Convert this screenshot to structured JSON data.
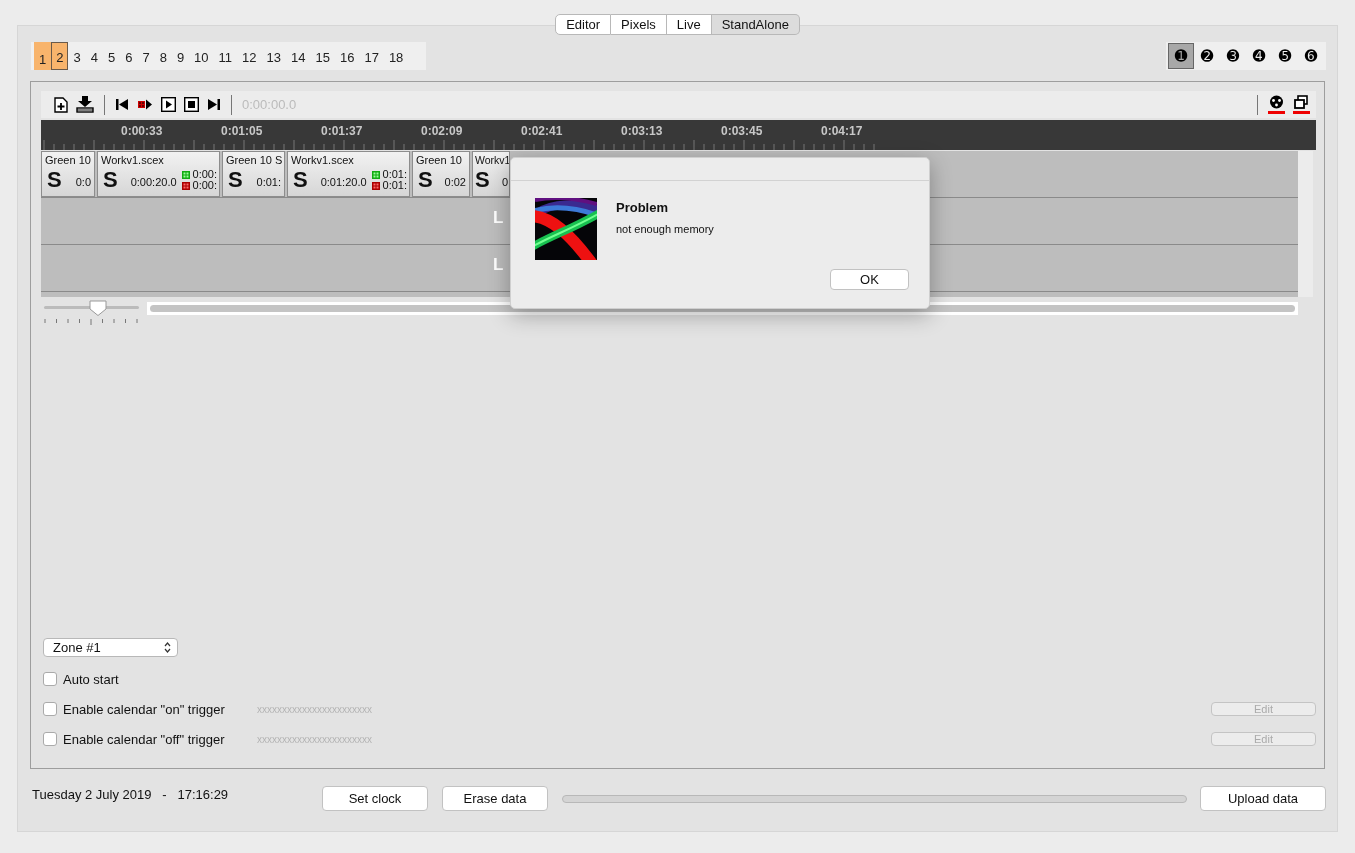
{
  "tabs": [
    {
      "label": "Editor",
      "selected": false
    },
    {
      "label": "Pixels",
      "selected": false
    },
    {
      "label": "Live",
      "selected": false
    },
    {
      "label": "StandAlone",
      "selected": true
    }
  ],
  "pages": [
    {
      "label": "1",
      "on": true,
      "selected": false
    },
    {
      "label": "2",
      "on": true,
      "selected": true
    },
    {
      "label": "3",
      "on": false,
      "selected": false
    },
    {
      "label": "4",
      "on": false,
      "selected": false
    },
    {
      "label": "5",
      "on": false,
      "selected": false
    },
    {
      "label": "6",
      "on": false,
      "selected": false
    },
    {
      "label": "7",
      "on": false,
      "selected": false
    },
    {
      "label": "8",
      "on": false,
      "selected": false
    },
    {
      "label": "9",
      "on": false,
      "selected": false
    },
    {
      "label": "10",
      "on": false,
      "selected": false
    },
    {
      "label": "11",
      "on": false,
      "selected": false
    },
    {
      "label": "12",
      "on": false,
      "selected": false
    },
    {
      "label": "13",
      "on": false,
      "selected": false
    },
    {
      "label": "14",
      "on": false,
      "selected": false
    },
    {
      "label": "15",
      "on": false,
      "selected": false
    },
    {
      "label": "16",
      "on": false,
      "selected": false
    },
    {
      "label": "17",
      "on": false,
      "selected": false
    },
    {
      "label": "18",
      "on": false,
      "selected": false
    }
  ],
  "outputs": [
    {
      "label": "➊",
      "selected": true
    },
    {
      "label": "➋",
      "selected": false
    },
    {
      "label": "➌",
      "selected": false
    },
    {
      "label": "➍",
      "selected": false
    },
    {
      "label": "➎",
      "selected": false
    },
    {
      "label": "➏",
      "selected": false
    }
  ],
  "toolbar": {
    "time": "0:00:00.0",
    "time_disabled": true
  },
  "ruler": {
    "labels": [
      "0:00:33",
      "0:01:05",
      "0:01:37",
      "0:02:09",
      "0:02:41",
      "0:03:13",
      "0:03:45",
      "0:04:17"
    ]
  },
  "tracks": [
    {
      "clips": [
        {
          "name": "Green 10",
          "symbol": "S",
          "time": "0:0"
        },
        {
          "name": "Workv1.scex",
          "symbol": "S",
          "time": "0:00:20.0",
          "start_mark": "0:00:",
          "end_mark": "0:00:"
        },
        {
          "name": "Green 10 S",
          "symbol": "S",
          "time": "0:01:"
        },
        {
          "name": "Workv1.scex",
          "symbol": "S",
          "time": "0:01:20.0",
          "start_mark": "0:01:",
          "end_mark": "0:01:"
        },
        {
          "name": "Green 10",
          "symbol": "S",
          "time": "0:02"
        },
        {
          "name": "Workv1",
          "symbol": "S",
          "time": "0"
        }
      ]
    },
    {
      "label": "L"
    },
    {
      "label": "L"
    }
  ],
  "zoom": {
    "level": 0.57
  },
  "zone_select": {
    "value": "Zone #1"
  },
  "options": [
    {
      "label": "Auto start",
      "checked": false
    },
    {
      "label": "Enable calendar \"on\" trigger",
      "checked": false,
      "schedule": "xxxxxxxxxxxxxxxxxxxxxxx",
      "button": {
        "label": "Edit",
        "disabled": true
      }
    },
    {
      "label": "Enable calendar \"off\" trigger",
      "checked": false,
      "schedule": "xxxxxxxxxxxxxxxxxxxxxxx",
      "button": {
        "label": "Edit",
        "disabled": true
      }
    }
  ],
  "status": {
    "date": "Tuesday 2 July 2019   -   17:16:29"
  },
  "buttons": [
    "Set clock",
    "Erase data"
  ],
  "progress": {
    "level": 0
  },
  "upload_button": "Upload data",
  "dialog": {
    "title": "Problem",
    "message": "not enough memory",
    "button": "OK"
  }
}
